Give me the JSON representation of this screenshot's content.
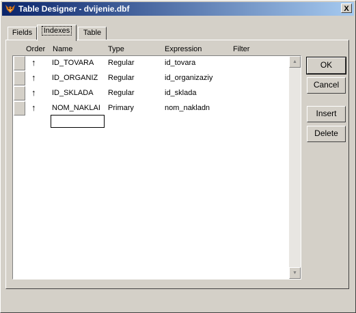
{
  "window": {
    "title": "Table Designer - dvijenie.dbf",
    "close_label": "X"
  },
  "tabs": [
    {
      "label": "Fields",
      "active": false
    },
    {
      "label": "Indexes",
      "active": true
    },
    {
      "label": "Table",
      "active": false
    }
  ],
  "grid": {
    "headers": {
      "order": "Order",
      "name": "Name",
      "type": "Type",
      "expression": "Expression",
      "filter": "Filter"
    },
    "rows": [
      {
        "order": "↑",
        "name": "ID_TOVARA",
        "type": "Regular",
        "expression": "id_tovara",
        "filter": ""
      },
      {
        "order": "↑",
        "name": "ID_ORGANIZ",
        "type": "Regular",
        "expression": "id_organizaziy",
        "filter": ""
      },
      {
        "order": "↑",
        "name": "ID_SKLADA",
        "type": "Regular",
        "expression": "id_sklada",
        "filter": ""
      },
      {
        "order": "↑",
        "name": "NOM_NAKLAI",
        "type": "Primary",
        "expression": "nom_nakladn",
        "filter": ""
      }
    ],
    "new_row_name_value": ""
  },
  "buttons": {
    "ok": "OK",
    "cancel": "Cancel",
    "insert": "Insert",
    "delete": "Delete"
  },
  "icons": {
    "app": "fox-icon",
    "order_asc": "arrow-up-icon",
    "scroll_up": "scroll-up-arrow-icon",
    "scroll_down": "scroll-down-arrow-icon"
  }
}
